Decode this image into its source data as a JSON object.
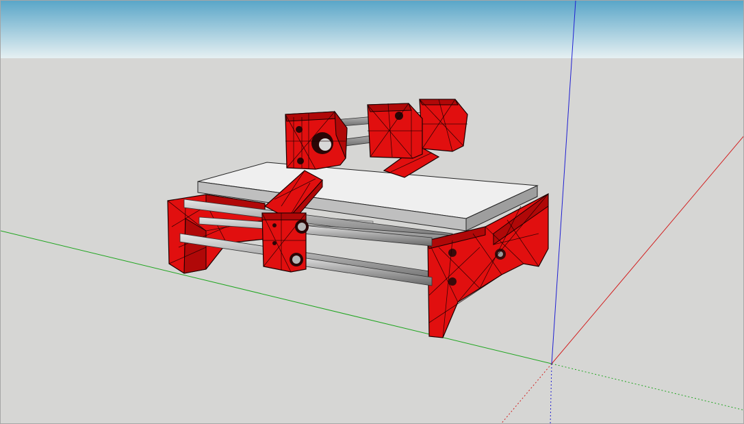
{
  "viewport": {
    "sky_color_top": "#5aa6c8",
    "sky_color_bottom": "#e6f0f2",
    "ground_color": "#d6d6d4"
  },
  "axes": {
    "red_axis_color": "#d21e1e",
    "green_axis_color": "#1ea51e",
    "blue_axis_color": "#1e1ed2"
  },
  "model": {
    "part_color": "#e10f0f",
    "edge_color": "#1a0000",
    "rod_color": "#a8a8a8",
    "bed_color": "#efefef"
  }
}
